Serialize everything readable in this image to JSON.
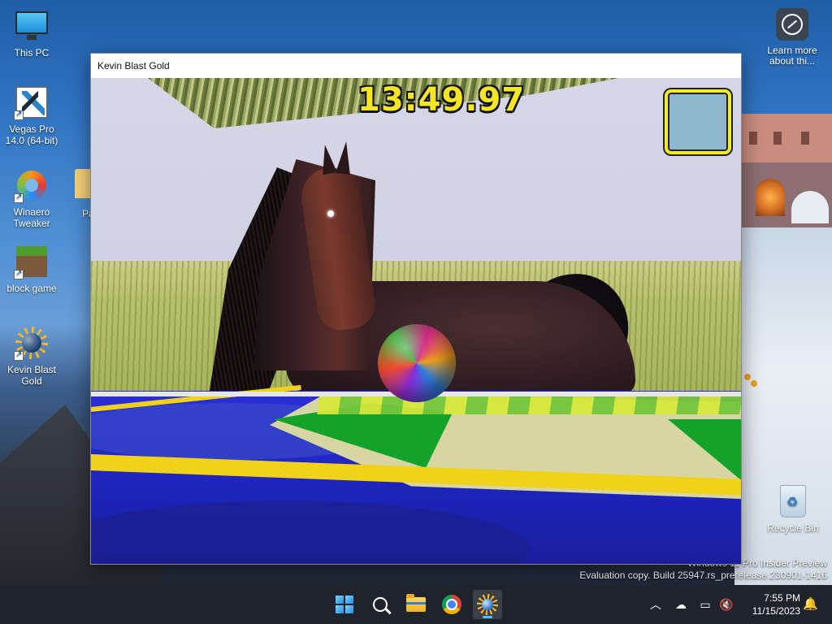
{
  "desktop": {
    "icons": [
      {
        "label": "This PC"
      },
      {
        "label": "Vegas Pro 14.0 (64-bit)"
      },
      {
        "label": "Winaero Tweaker"
      },
      {
        "label": "block game"
      },
      {
        "label": "Kevin Blast Gold"
      }
    ],
    "partial_icon_label": "Pa",
    "learn_more_label": "Learn more about thi...",
    "recycle_bin_label": "Recycle Bin",
    "watermark": {
      "line1": "Windows 11 Pro Insider Preview",
      "line2": "Evaluation copy. Build 25947.rs_prerelease.230901-1416"
    }
  },
  "window": {
    "title": "Kevin Blast Gold"
  },
  "game": {
    "timer": "13:49.97",
    "minimap_color": "#8fb7cc",
    "timer_color": "#f4e626"
  },
  "taskbar": {
    "items": [
      {
        "name": "start",
        "icon": "windows-start-icon"
      },
      {
        "name": "search",
        "icon": "search-icon"
      },
      {
        "name": "file-explorer",
        "icon": "folder-icon"
      },
      {
        "name": "chrome",
        "icon": "chrome-icon"
      },
      {
        "name": "kevin-blast-gold",
        "icon": "sunball-icon",
        "active": true
      }
    ],
    "clock": {
      "time": "7:55 PM",
      "date": "11/15/2023"
    }
  }
}
